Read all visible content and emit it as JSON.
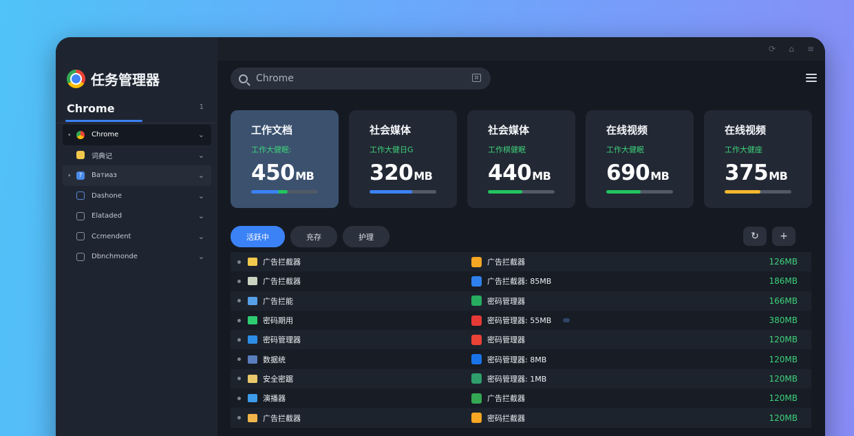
{
  "app": {
    "title": "任务管理器",
    "search_placeholder": "Chrome"
  },
  "sidebar": {
    "section": "Chrome",
    "section_mark": "1",
    "items": [
      {
        "label": "Chrome",
        "icon": "chrome-icon",
        "active": true
      },
      {
        "label": "词典记",
        "icon": "folder-icon"
      },
      {
        "label": "Ватиаз",
        "icon": "help-icon",
        "highlight": true
      },
      {
        "label": "Dashone",
        "icon": "window-icon"
      },
      {
        "label": "Elataded",
        "icon": "list-icon"
      },
      {
        "label": "Ccmendent",
        "icon": "image-icon"
      },
      {
        "label": "Dbnchmonde",
        "icon": "shield-icon"
      }
    ]
  },
  "cards": [
    {
      "title": "工作文档",
      "subtitle": "工作大健眠:",
      "value": "450",
      "unit": "MB",
      "bar": 0.55,
      "bar_color": "#3b82f6",
      "bar_color2": "#22c55e"
    },
    {
      "title": "社会媒体",
      "subtitle": "工作大健日G",
      "value": "320",
      "unit": "MB",
      "bar": 0.64,
      "bar_color": "#3b82f6"
    },
    {
      "title": "社会媒体",
      "subtitle": "工作棋健眠",
      "value": "440",
      "unit": "MB",
      "bar": 0.52,
      "bar_color": "#22c55e"
    },
    {
      "title": "在线视频",
      "subtitle": "工作大健眠",
      "value": "690",
      "unit": "MB",
      "bar": 0.52,
      "bar_color": "#22c55e"
    },
    {
      "title": "在线视频",
      "subtitle": "工作大健座",
      "value": "375",
      "unit": "MB",
      "bar": 0.54,
      "bar_color": "#f5b82e"
    }
  ],
  "tabs": [
    "活跃中",
    "充存",
    "护理"
  ],
  "toolbar": {
    "refresh_icon": "refresh-icon",
    "add_label": "+"
  },
  "processes": [
    {
      "name": "广告拦截器",
      "icon_color": "#f2c94c",
      "name2": "广告拦截器",
      "icon2_color": "#f5a623",
      "memory": "126MB"
    },
    {
      "name": "广告拦截器",
      "icon_color": "#c9d4c0",
      "name2": "广告拦截器: 85MB",
      "icon2_color": "#2f80ed",
      "memory": "186MB"
    },
    {
      "name": "广告拦能",
      "icon_color": "#56a0e8",
      "name2": "密码管理器",
      "icon2_color": "#27ae60",
      "memory": "166MB"
    },
    {
      "name": "密码期用",
      "icon_color": "#2ecc71",
      "name2": "密码管理器: 55MB",
      "icon2_color": "#e53935",
      "memory": "380MB",
      "tag": true
    },
    {
      "name": "密码管理器",
      "icon_color": "#2d8ee8",
      "name2": "密码管理器",
      "icon2_color": "#ea4335",
      "memory": "120MB"
    },
    {
      "name": "数据统",
      "icon_color": "#5a7dbd",
      "name2": "密码管理器: 8MB",
      "icon2_color": "#1a73e8",
      "memory": "120MB"
    },
    {
      "name": "安全密踞",
      "icon_color": "#e8c86a",
      "name2": "密码管理器: 1MB",
      "icon2_color": "#2e9e6a",
      "memory": "120MB"
    },
    {
      "name": "演播器",
      "icon_color": "#3d9be9",
      "name2": "广告拦截器",
      "icon2_color": "#34a853",
      "memory": "120MB"
    },
    {
      "name": "广告拦截器",
      "icon_color": "#f0b54a",
      "name2": "密码拦截器",
      "icon2_color": "#f5a623",
      "memory": "120MB"
    }
  ]
}
